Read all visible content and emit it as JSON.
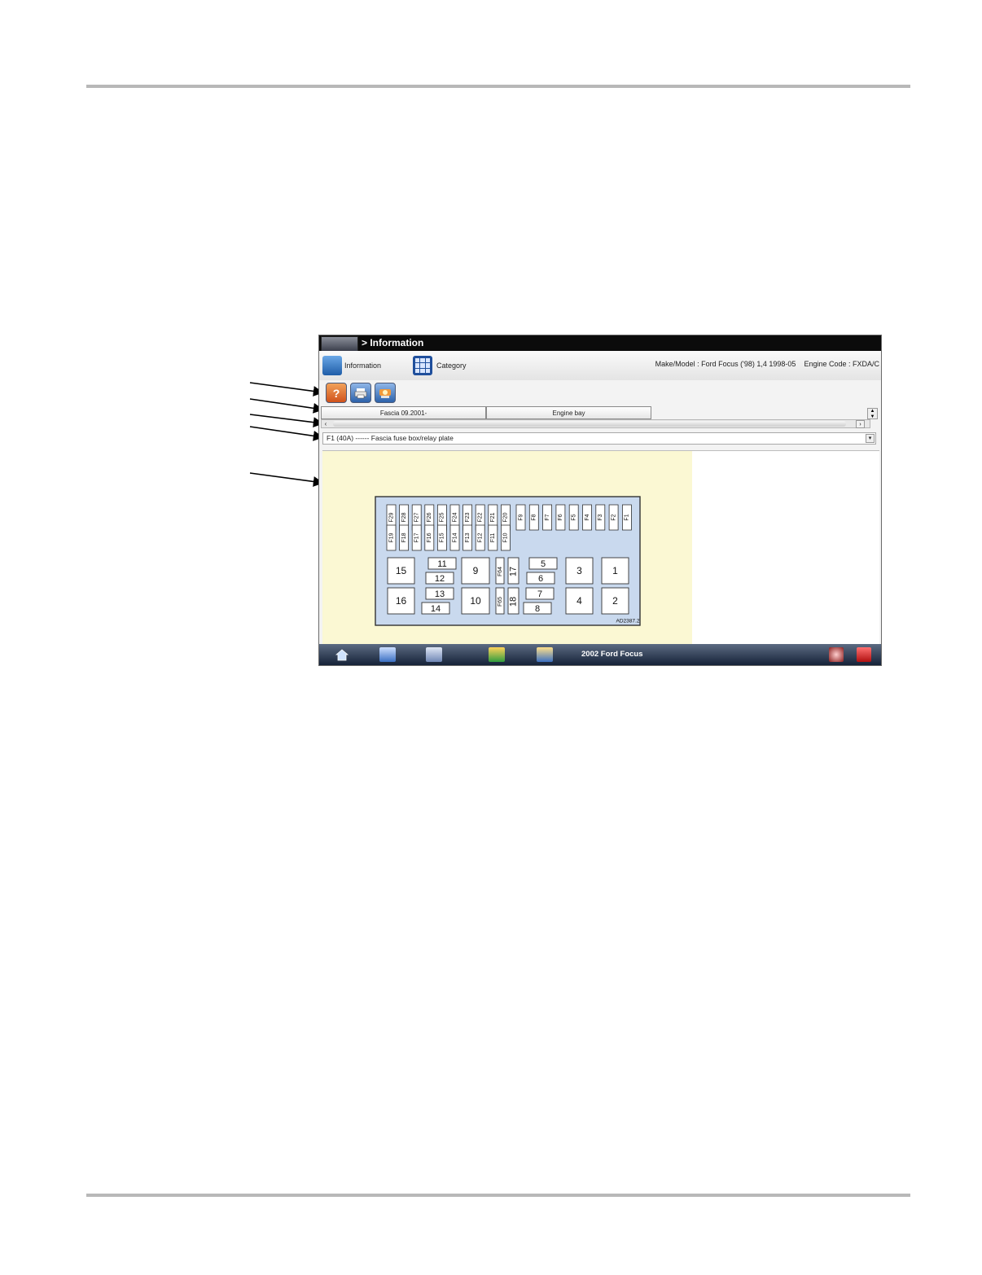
{
  "window": {
    "title": "> Information"
  },
  "toolbar": {
    "information_label": "Information",
    "category_label": "Category",
    "make_model": "Make/Model : Ford Focus ('98) 1,4 1998-05",
    "engine_code": "Engine Code : FXDA/C"
  },
  "action_buttons": [
    {
      "icon": "help-icon",
      "glyph": "?"
    },
    {
      "icon": "print-icon",
      "glyph": ""
    },
    {
      "icon": "component-icon",
      "glyph": ""
    }
  ],
  "tabs": [
    {
      "label": "Fascia 09.2001-"
    },
    {
      "label": "Engine bay"
    }
  ],
  "fuse_select": {
    "value": "F1 (40A) ------ Fascia fuse box/relay plate"
  },
  "diagram": {
    "top_row_a": [
      "F29",
      "F28",
      "F27",
      "F26",
      "F25",
      "F24",
      "F23",
      "F22",
      "F21",
      "F20"
    ],
    "top_row_b": [
      "F9",
      "F8",
      "F7",
      "F6",
      "F5",
      "F4",
      "F3",
      "F2",
      "F1"
    ],
    "bottom_row": [
      "F19",
      "F18",
      "F17",
      "F16",
      "F15",
      "F14",
      "F13",
      "F12",
      "F11",
      "F10"
    ],
    "relays": [
      "15",
      "16",
      "11",
      "12",
      "13",
      "14",
      "9",
      "10",
      "F64",
      "F65",
      "17",
      "18",
      "5",
      "6",
      "7",
      "8",
      "3",
      "4",
      "1",
      "2"
    ],
    "code": "AD2387.2"
  },
  "statusbar": {
    "vehicle": "2002 Ford Focus",
    "icons": [
      "home-icon",
      "toolbox-icon",
      "scanner-icon",
      "vehicle-data-icon",
      "info-icon",
      "connection-icon",
      "battery-icon"
    ]
  }
}
